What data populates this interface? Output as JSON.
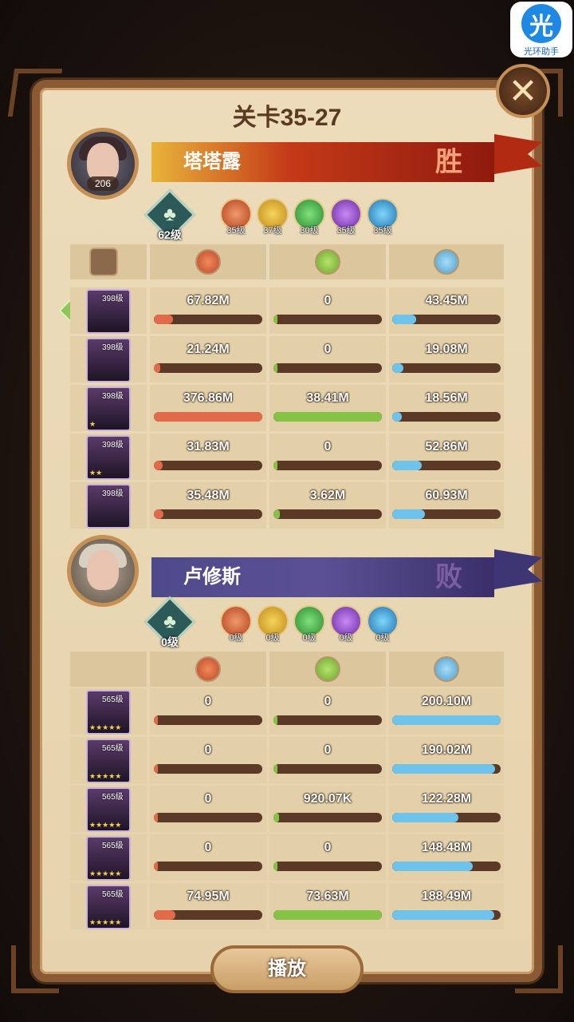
{
  "title": "关卡35-27",
  "app_badge": {
    "glyph": "光",
    "caption": "光环助手"
  },
  "close_glyph": "✕",
  "play_label": "播放",
  "colors": {
    "damage": "#e06a4a",
    "heal": "#86c246",
    "defense": "#6ec3ec"
  },
  "team_a": {
    "name": "塔塔露",
    "result": "胜",
    "avatar_level": "206",
    "tree_level": "62级",
    "faction_levels": [
      "35级",
      "37级",
      "30级",
      "35级",
      "35级"
    ],
    "heroes": [
      {
        "level": "398级",
        "stars": "",
        "damage": "67.82M",
        "heal": "0",
        "defense": "43.45M",
        "damage_pct": 18,
        "heal_pct": 0,
        "defense_pct": 22
      },
      {
        "level": "398级",
        "stars": "",
        "damage": "21.24M",
        "heal": "0",
        "defense": "19.08M",
        "damage_pct": 6,
        "heal_pct": 0,
        "defense_pct": 10
      },
      {
        "level": "398级",
        "stars": "★",
        "damage": "376.86M",
        "heal": "38.41M",
        "defense": "18.56M",
        "damage_pct": 100,
        "heal_pct": 100,
        "defense_pct": 9
      },
      {
        "level": "398级",
        "stars": "★★",
        "damage": "31.83M",
        "heal": "0",
        "defense": "52.86M",
        "damage_pct": 8,
        "heal_pct": 0,
        "defense_pct": 27
      },
      {
        "level": "398级",
        "stars": "",
        "damage": "35.48M",
        "heal": "3.62M",
        "defense": "60.93M",
        "damage_pct": 9,
        "heal_pct": 6,
        "defense_pct": 30
      }
    ]
  },
  "team_b": {
    "name": "卢修斯",
    "result": "败",
    "tree_level": "0级",
    "faction_levels": [
      "0级",
      "0级",
      "0级",
      "0级",
      "0级"
    ],
    "heroes": [
      {
        "level": "565级",
        "stars": "★★★★★",
        "damage": "0",
        "heal": "0",
        "defense": "200.10M",
        "damage_pct": 0,
        "heal_pct": 0,
        "defense_pct": 100
      },
      {
        "level": "565级",
        "stars": "★★★★★",
        "damage": "0",
        "heal": "0",
        "defense": "190.02M",
        "damage_pct": 0,
        "heal_pct": 0,
        "defense_pct": 95
      },
      {
        "level": "565级",
        "stars": "★★★★★",
        "damage": "0",
        "heal": "920.07K",
        "defense": "122.28M",
        "damage_pct": 0,
        "heal_pct": 1,
        "defense_pct": 61
      },
      {
        "level": "565级",
        "stars": "★★★★★",
        "damage": "0",
        "heal": "0",
        "defense": "148.48M",
        "damage_pct": 0,
        "heal_pct": 0,
        "defense_pct": 74
      },
      {
        "level": "565级",
        "stars": "★★★★★",
        "damage": "74.95M",
        "heal": "73.63M",
        "defense": "188.49M",
        "damage_pct": 20,
        "heal_pct": 100,
        "defense_pct": 94
      }
    ]
  }
}
